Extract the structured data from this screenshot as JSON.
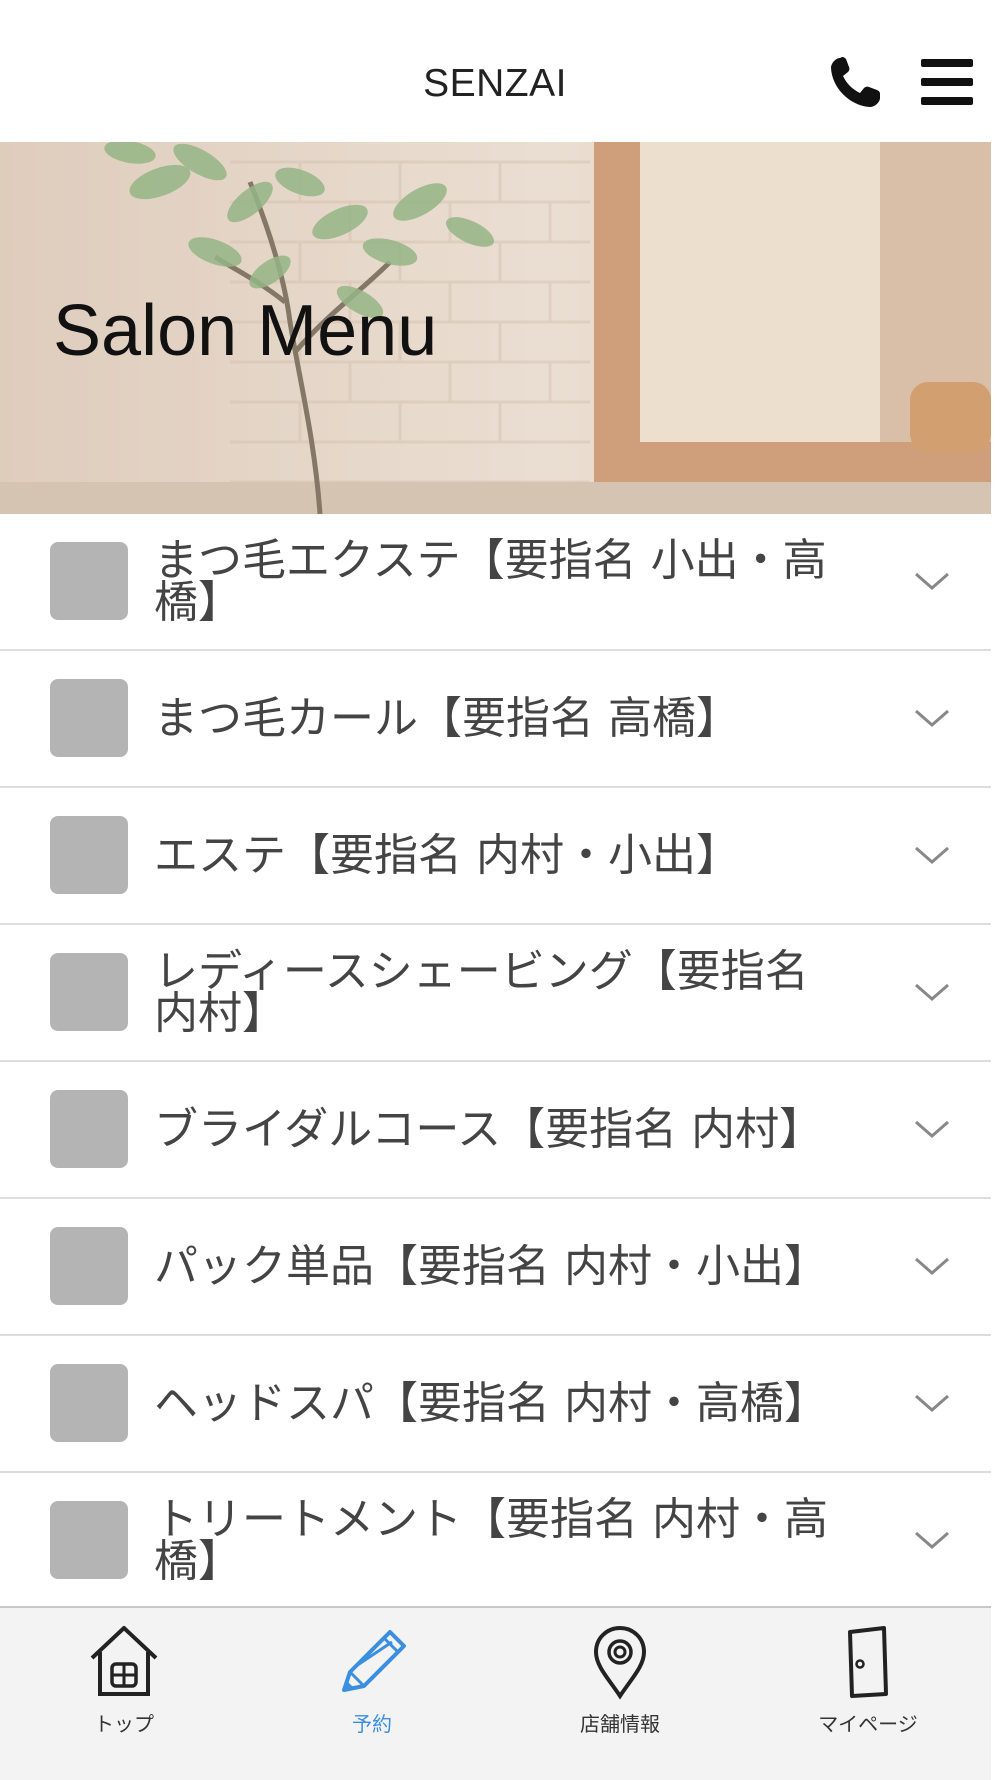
{
  "header": {
    "title": "SENZAI",
    "phone_icon": "phone-icon",
    "menu_icon": "hamburger-menu-icon"
  },
  "hero": {
    "title": "Salon Menu"
  },
  "menu_items": [
    {
      "label": "まつ毛エクステ【要指名 小出・高橋】"
    },
    {
      "label": "まつ毛カール【要指名 高橋】"
    },
    {
      "label": "エステ【要指名 内村・小出】"
    },
    {
      "label": "レディースシェービング【要指名 内村】"
    },
    {
      "label": "ブライダルコース【要指名 内村】"
    },
    {
      "label": "パック単品【要指名 内村・小出】"
    },
    {
      "label": "ヘッドスパ【要指名 内村・高橋】"
    },
    {
      "label": "トリートメント【要指名 内村・高橋】"
    }
  ],
  "tabbar": {
    "tabs": [
      {
        "label": "トップ",
        "icon": "home-icon"
      },
      {
        "label": "予約",
        "icon": "pencil-icon",
        "active": true
      },
      {
        "label": "店舗情報",
        "icon": "map-pin-icon"
      },
      {
        "label": "マイページ",
        "icon": "door-icon"
      }
    ]
  },
  "colors": {
    "accent": "#3b8fe0",
    "thumb": "#b4b4b4",
    "divider": "#dddddd",
    "tabbar_bg": "#f3f3f3"
  }
}
